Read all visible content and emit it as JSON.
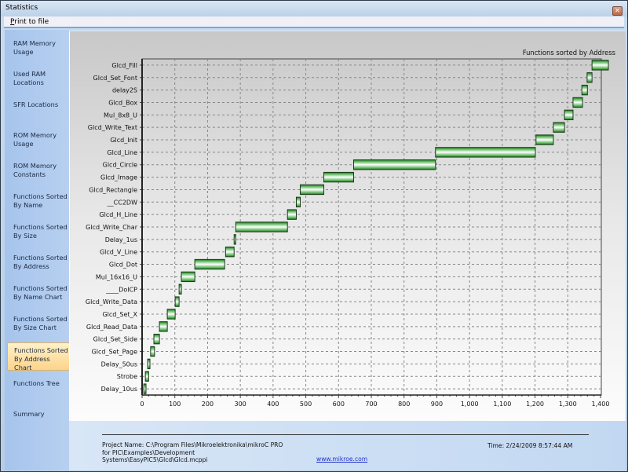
{
  "window": {
    "title": "Statistics",
    "close_icon": "close-icon"
  },
  "menu": {
    "print_to_file": "Print to file",
    "print_to_file_mnemonic": "P",
    "print_to_file_rest": "rint to file"
  },
  "sidebar": {
    "items": [
      {
        "label_line1": "RAM Memory",
        "label_line2": "Usage",
        "active": false
      },
      {
        "label_line1": "Used RAM",
        "label_line2": "Locations",
        "active": false
      },
      {
        "label_line1": "SFR Locations",
        "label_line2": "",
        "active": false
      },
      {
        "label_line1": "ROM Memory",
        "label_line2": "Usage",
        "active": false
      },
      {
        "label_line1": "ROM Memory",
        "label_line2": "Constants",
        "active": false
      },
      {
        "label_line1": "Functions Sorted",
        "label_line2": "By  Name",
        "active": false
      },
      {
        "label_line1": "Functions Sorted",
        "label_line2": "By Size",
        "active": false
      },
      {
        "label_line1": "Functions Sorted",
        "label_line2": "By Address",
        "active": false
      },
      {
        "label_line1": "Functions Sorted",
        "label_line2": "By Name Chart",
        "active": false
      },
      {
        "label_line1": "Functions Sorted",
        "label_line2": "By Size Chart",
        "active": false
      },
      {
        "label_line1": "Functions Sorted",
        "label_line2": "By Address Chart",
        "active": true
      },
      {
        "label_line1": "Functions Tree",
        "label_line2": "",
        "active": false
      },
      {
        "label_line1": "Summary",
        "label_line2": "",
        "active": false
      }
    ]
  },
  "footer": {
    "project_line1": "Project Name: C:\\Program Files\\Mikroelektronika\\mikroC PRO",
    "project_line2": "for PIC\\Examples\\Development",
    "project_line3": "Systems\\EasyPIC5\\Glcd\\Glcd.mcppi",
    "website": "www.mikroe.com",
    "time": "Time: 2/24/2009 8:57:44 AM"
  },
  "colors": {
    "bar_dark": "#1f7a1f",
    "bar_light": "#ffffff",
    "active_tab": "#fcd48b"
  },
  "chart_data": {
    "type": "bar",
    "orientation": "horizontal-range",
    "title": "Functions sorted by Address",
    "xlabel": "",
    "ylabel": "",
    "xlim": [
      0,
      1400
    ],
    "xticks": [
      "0",
      "100",
      "200",
      "300",
      "400",
      "500",
      "600",
      "700",
      "800",
      "900",
      "1,000",
      "1,100",
      "1,200",
      "1,300",
      "1,400"
    ],
    "grid": true,
    "categories": [
      "Glcd_Fill",
      "Glcd_Set_Font",
      "delay2S",
      "Glcd_Box",
      "Mul_8x8_U",
      "Glcd_Write_Text",
      "Glcd_Init",
      "Glcd_Line",
      "Glcd_Circle",
      "Glcd_Image",
      "Glcd_Rectangle",
      "__CC2DW",
      "Glcd_H_Line",
      "Glcd_Write_Char",
      "Delay_1us",
      "Glcd_V_Line",
      "Glcd_Dot",
      "Mul_16x16_U",
      "____DoICP",
      "Glcd_Write_Data",
      "Glcd_Set_X",
      "Glcd_Read_Data",
      "Glcd_Set_Side",
      "Glcd_Set_Page",
      "Delay_50us",
      "Strobe",
      "Delay_10us"
    ],
    "start": [
      1374,
      1359,
      1343,
      1316,
      1290,
      1256,
      1203,
      896,
      646,
      555,
      483,
      471,
      444,
      286,
      281,
      255,
      161,
      120,
      113,
      101,
      77,
      53,
      36,
      26,
      17,
      10,
      5
    ],
    "end": [
      1424,
      1374,
      1360,
      1345,
      1316,
      1290,
      1256,
      1201,
      896,
      646,
      555,
      483,
      471,
      444,
      286,
      281,
      252,
      161,
      120,
      113,
      101,
      77,
      53,
      38,
      24,
      20,
      12
    ]
  }
}
